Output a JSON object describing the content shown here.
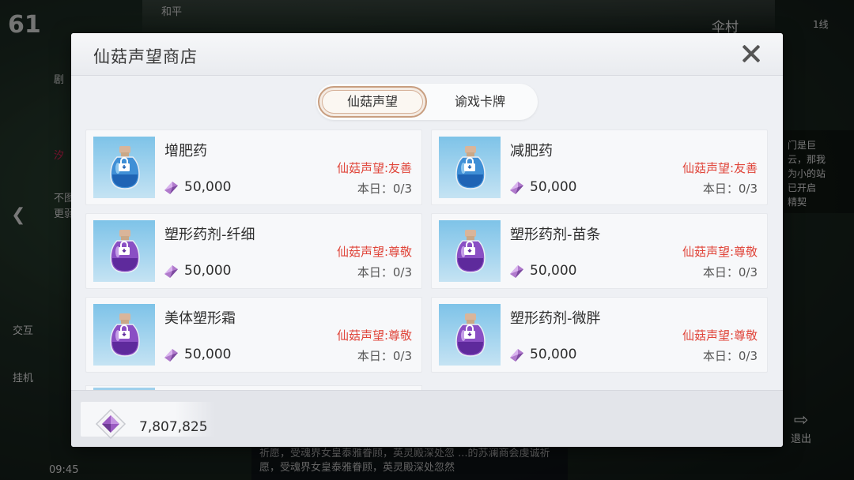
{
  "hud": {
    "level": "61",
    "peace_mode": "和平",
    "village": "伞村",
    "channel": "1线",
    "time": "09:45",
    "side_labels": [
      "剧",
      "汐",
      "不图",
      "更弱",
      "交互",
      "挂机"
    ],
    "right_panel": [
      "门是巨",
      "云，那我",
      "为小的站",
      "已开启",
      "精契"
    ],
    "chat_text": "祈愿，受魂界女皇泰雅眷顾，英灵殿深处忽 ...的苏澜商会虔诚祈愿，受魂界女皇泰雅眷顾，英灵殿深处忽然",
    "exit_label": "退出"
  },
  "dialog": {
    "title": "仙菇声望商店",
    "tabs": [
      {
        "label": "仙菇声望",
        "active": true
      },
      {
        "label": "谕戏卡牌",
        "active": false
      }
    ],
    "items": [
      {
        "name": "增肥药",
        "requirement": "仙菇声望:友善",
        "price": "50,000",
        "daily": "本日：0/3",
        "bottle": "blue"
      },
      {
        "name": "减肥药",
        "requirement": "仙菇声望:友善",
        "price": "50,000",
        "daily": "本日：0/3",
        "bottle": "blue"
      },
      {
        "name": "塑形药剂-纤细",
        "requirement": "仙菇声望:尊敬",
        "price": "50,000",
        "daily": "本日：0/3",
        "bottle": "purple"
      },
      {
        "name": "塑形药剂-苗条",
        "requirement": "仙菇声望:尊敬",
        "price": "50,000",
        "daily": "本日：0/3",
        "bottle": "purple"
      },
      {
        "name": "美体塑形霜",
        "requirement": "仙菇声望:尊敬",
        "price": "50,000",
        "daily": "本日：0/3",
        "bottle": "purple"
      },
      {
        "name": "塑形药剂-微胖",
        "requirement": "仙菇声望:尊敬",
        "price": "50,000",
        "daily": "本日：0/3",
        "bottle": "purple"
      }
    ],
    "currency_amount": "7,807,825",
    "colors": {
      "requirement": "#e0453a",
      "accent_border": "#c89e80"
    }
  }
}
